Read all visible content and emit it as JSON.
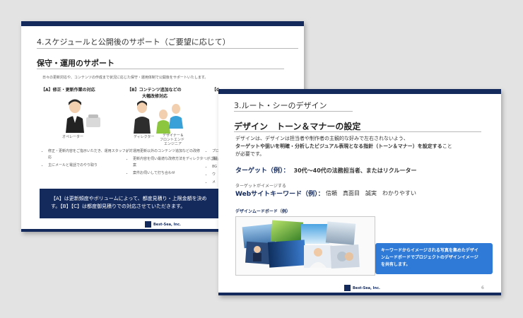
{
  "slide_back": {
    "title": "4.スケジュールと公開後のサポート（ご要望に応じて）",
    "heading": "保守・運用のサポート",
    "intro": "日々の更新対応や、コンテンツの作成まで状況に応じた保守・運用体制で公開後をサポートいたします。",
    "columns": [
      {
        "head_line1": "【A】修正・更新作業の対応",
        "head_line2": "",
        "figure_labels": [
          "オペレーター"
        ],
        "bullets": [
          "修正・更新内容をご指示いただき、運用スタッフが対応",
          "主にメールと電話でのやり取り"
        ]
      },
      {
        "head_line1": "【B】コンテンツ追加などの",
        "head_line2": "大幅改修対応",
        "figure_labels": [
          "ディレクター",
          "デザイナー＆",
          "フロントエンド",
          "エンジニア"
        ],
        "bullets": [
          "運用更新以外のコンテンツ追加などの改修",
          "更新内容を伺い最適な改修方法をディレクターがご提案",
          "案件お伺いして打ち合わせ"
        ]
      },
      {
        "head_line1": "【C",
        "head_line2": "",
        "figure_labels": [],
        "bullets": [
          "プロ",
          "最も",
          "8G",
          "ウ",
          "メ"
        ]
      }
    ],
    "note_line1": "【A】は更新頻度やボリュームによって、都度見積り・上限金額を決め",
    "note_line2": "す。【B】【C】は都度御見積りでの対応させていただきます。",
    "logo_text": "Best-Sea, Inc."
  },
  "slide_front": {
    "title": "3.ルート・シーのデザイン",
    "heading": "デザイン　トーン＆マナーの設定",
    "body_line1": "デザインは、デザインは担当者や制作者の主観的な好みで左右されないよう、",
    "body_line2_bold": "ターゲットや狙いを明確・分析したビジュアル表現となる指針（トーン＆マナー）を設定する",
    "body_line2_tail": "こと",
    "body_line3": "が必要です。",
    "target_label": "ターゲット（例）：",
    "target_value": "30代〜40代の法務担当者、またはリクルーター",
    "kw_small": "ターゲットがイメージする",
    "kw_label": "Webサイトキーワード（例）：",
    "kw_words": "信頼　真面目　誠実　わかりやすい",
    "moodboard_label": "デザインムードボード（例）",
    "callout_line1": "キーワードからイメージされる写真を集めたデザイ",
    "callout_line2": "ンムードボードでプロジェクトのデザインイメージ",
    "callout_line3": "を共有します。",
    "page_number": "6",
    "logo_text": "Best-Sea, Inc."
  },
  "colors": {
    "navy": "#142a5c",
    "callout_blue": "#2f7ad6",
    "background": "#e3e3e3"
  }
}
